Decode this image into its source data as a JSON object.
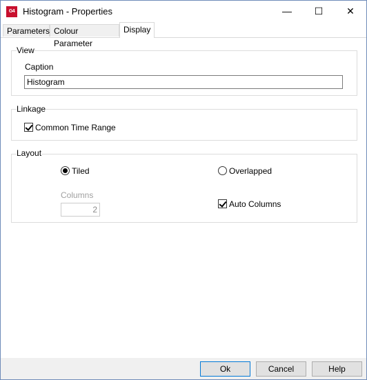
{
  "window": {
    "title": "Histogram - Properties",
    "icon_text": "G4",
    "minimize_glyph": "—",
    "maximize_glyph": "☐",
    "close_glyph": "✕"
  },
  "tabs": [
    {
      "label": "Parameters",
      "active": false
    },
    {
      "label": "Colour Parameter",
      "active": false
    },
    {
      "label": "Display",
      "active": true
    }
  ],
  "view": {
    "group_label": "View",
    "caption_label": "Caption",
    "caption_value": "Histogram"
  },
  "linkage": {
    "group_label": "Linkage",
    "common_time_range_label": "Common Time Range",
    "common_time_range_checked": true
  },
  "layout": {
    "group_label": "Layout",
    "tiled_label": "Tiled",
    "tiled_selected": true,
    "overlapped_label": "Overlapped",
    "overlapped_selected": false,
    "columns_label": "Columns",
    "columns_value": "2",
    "auto_columns_label": "Auto Columns",
    "auto_columns_checked": true
  },
  "buttons": {
    "ok": "Ok",
    "cancel": "Cancel",
    "help": "Help"
  }
}
